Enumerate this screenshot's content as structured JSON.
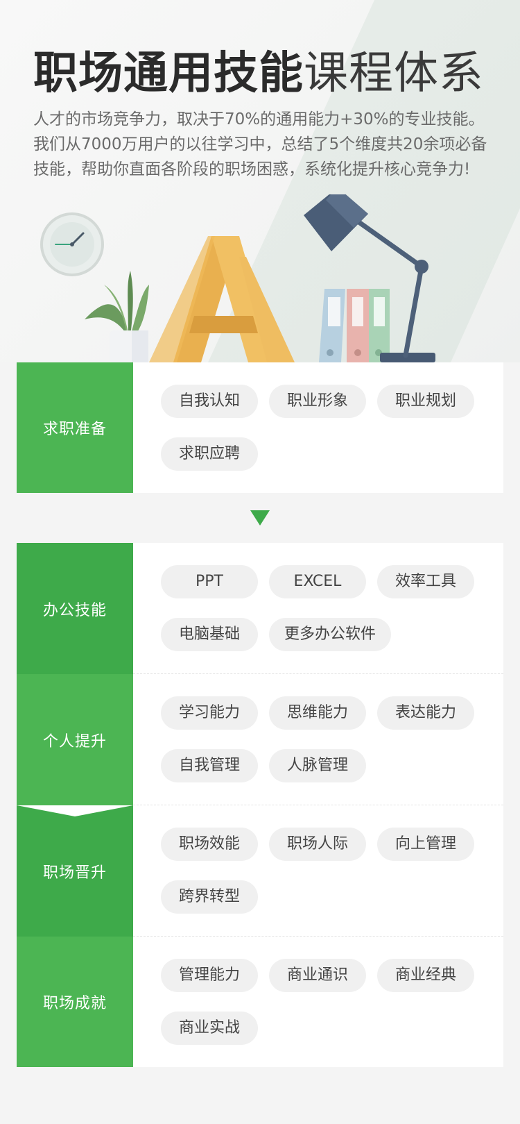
{
  "header": {
    "title_bold": "职场通用技能",
    "title_light": "课程体系",
    "description": "人才的市场竞争力，取决于70%的通用能力+30%的专业技能。我们从7000万用户的以往学习中，总结了5个维度共20余项必备技能，帮助你直面各阶段的职场困惑，系统化提升核心竞争力!"
  },
  "colors": {
    "green_dark": "#3eaa4a",
    "green_light": "#4cb553",
    "tag_bg": "#f0f0f0",
    "tag_text": "#444444"
  },
  "sections": [
    {
      "label": "求职准备",
      "tags": [
        "自我认知",
        "职业形象",
        "职业规划",
        "求职应聘"
      ]
    },
    {
      "label": "办公技能",
      "tags": [
        "PPT",
        "EXCEL",
        "效率工具",
        "电脑基础",
        "更多办公软件"
      ]
    },
    {
      "label": "个人提升",
      "tags": [
        "学习能力",
        "思维能力",
        "表达能力",
        "自我管理",
        "人脉管理"
      ]
    },
    {
      "label": "职场晋升",
      "tags": [
        "职场效能",
        "职场人际",
        "向上管理",
        "跨界转型"
      ]
    },
    {
      "label": "职场成就",
      "tags": [
        "管理能力",
        "商业通识",
        "商业经典",
        "商业实战"
      ]
    }
  ]
}
